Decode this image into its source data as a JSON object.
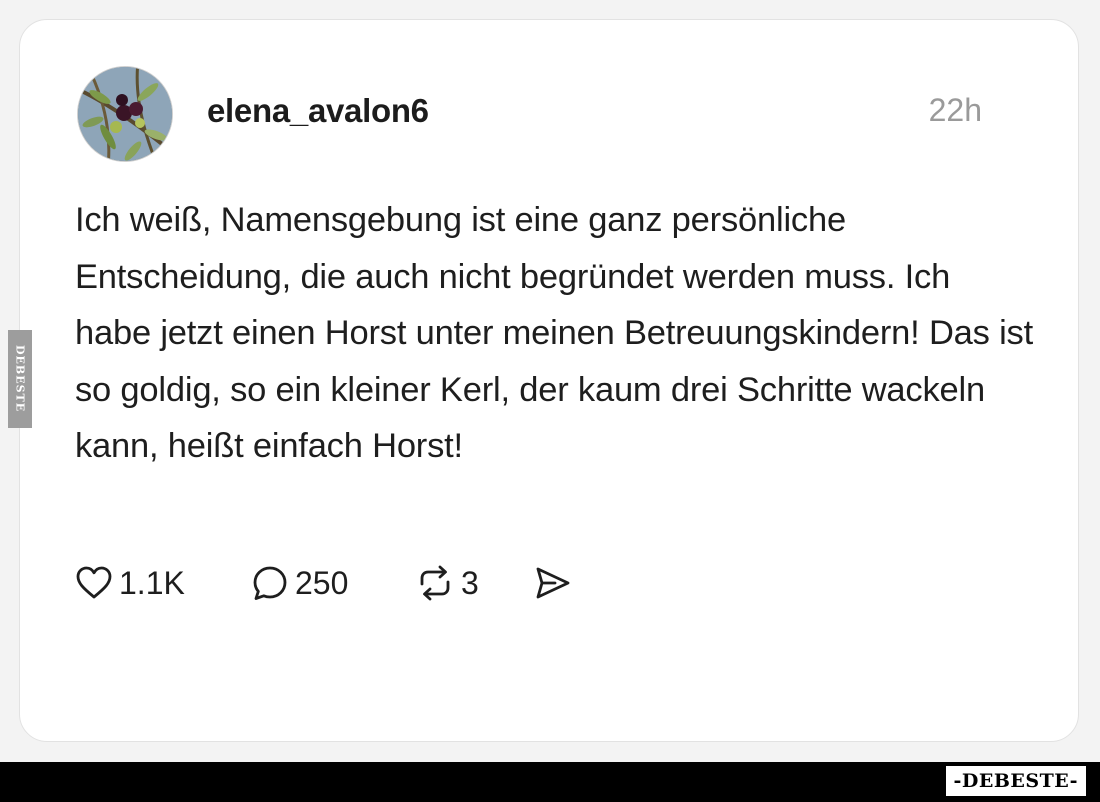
{
  "post": {
    "username": "elena_avalon6",
    "time": "22h",
    "text": "Ich weiß, Namensgebung ist eine ganz persönliche Entscheidung, die auch nicht begründet werden muss. Ich habe jetzt einen Horst unter meinen Betreuungskindern! Das ist so goldig, so ein kleiner Kerl, der kaum drei Schritte wackeln kann, heißt einfach Horst!"
  },
  "actions": {
    "likes": "1.1K",
    "replies": "250",
    "reposts": "3"
  },
  "icons": {
    "like": "heart-icon",
    "reply": "comment-icon",
    "repost": "repost-icon",
    "share": "send-icon"
  },
  "watermark": {
    "side": "DEBESTE",
    "bottom": "-DEBESTE-"
  },
  "colors": {
    "card_bg": "#ffffff",
    "text": "#1e1e1e",
    "muted": "#9a9a9a",
    "bar": "#000000"
  }
}
